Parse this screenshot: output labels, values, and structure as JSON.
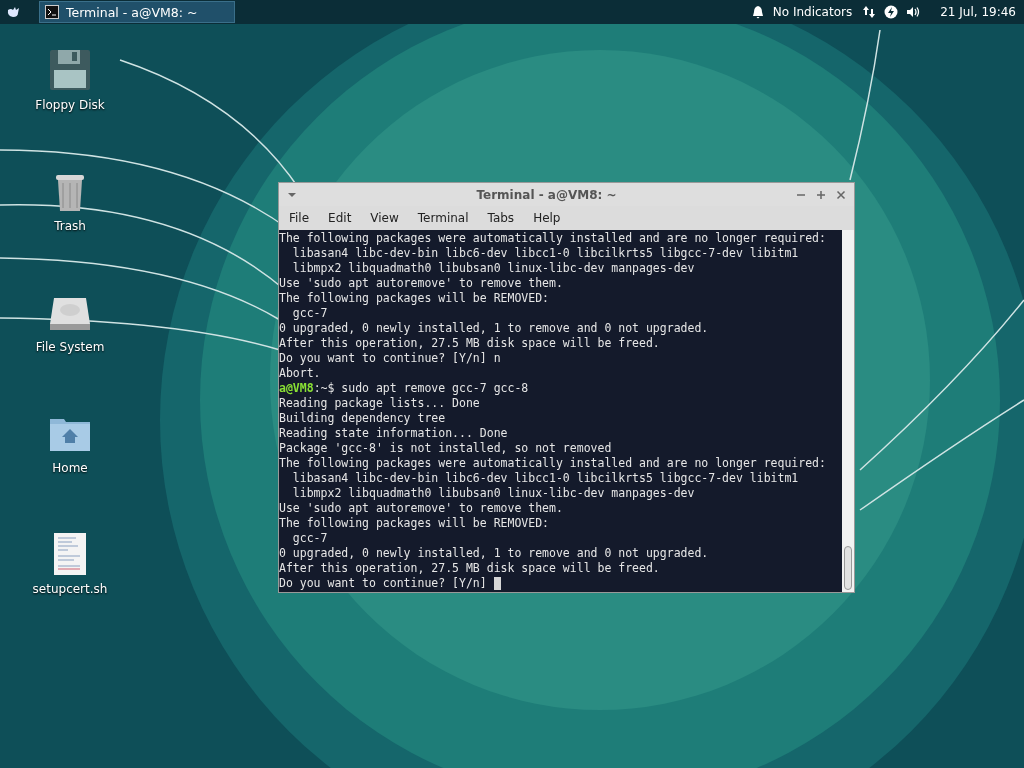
{
  "top_panel": {
    "taskbar": [
      {
        "title": "Terminal - a@VM8: ~",
        "selected": true
      }
    ],
    "indicator_label": "No Indicators",
    "clock": "21 Jul, 19:46"
  },
  "desktop_icons": [
    {
      "label": "Floppy Disk",
      "kind": "floppy"
    },
    {
      "label": "Trash",
      "kind": "trash"
    },
    {
      "label": "File System",
      "kind": "drive"
    },
    {
      "label": "Home",
      "kind": "home"
    },
    {
      "label": "setupcert.sh",
      "kind": "script"
    }
  ],
  "terminal": {
    "title": "Terminal - a@VM8: ~",
    "menu": [
      "File",
      "Edit",
      "View",
      "Terminal",
      "Tabs",
      "Help"
    ],
    "lines": [
      {
        "kind": "output",
        "text": "The following packages were automatically installed and are no longer required:"
      },
      {
        "kind": "output",
        "text": "  libasan4 libc-dev-bin libc6-dev libcc1-0 libcilkrts5 libgcc-7-dev libitm1"
      },
      {
        "kind": "output",
        "text": "  libmpx2 libquadmath0 libubsan0 linux-libc-dev manpages-dev"
      },
      {
        "kind": "output",
        "text": "Use 'sudo apt autoremove' to remove them."
      },
      {
        "kind": "output",
        "text": "The following packages will be REMOVED:"
      },
      {
        "kind": "output",
        "text": "  gcc-7"
      },
      {
        "kind": "output",
        "text": "0 upgraded, 0 newly installed, 1 to remove and 0 not upgraded."
      },
      {
        "kind": "output",
        "text": "After this operation, 27.5 MB disk space will be freed."
      },
      {
        "kind": "output",
        "text": "Do you want to continue? [Y/n] n"
      },
      {
        "kind": "output",
        "text": "Abort."
      },
      {
        "kind": "prompt",
        "user": "a@VM8",
        "text": ":~$ sudo apt remove gcc-7 gcc-8"
      },
      {
        "kind": "output",
        "text": "Reading package lists... Done"
      },
      {
        "kind": "output",
        "text": "Building dependency tree"
      },
      {
        "kind": "output",
        "text": "Reading state information... Done"
      },
      {
        "kind": "output",
        "text": "Package 'gcc-8' is not installed, so not removed"
      },
      {
        "kind": "output",
        "text": "The following packages were automatically installed and are no longer required:"
      },
      {
        "kind": "output",
        "text": "  libasan4 libc-dev-bin libc6-dev libcc1-0 libcilkrts5 libgcc-7-dev libitm1"
      },
      {
        "kind": "output",
        "text": "  libmpx2 libquadmath0 libubsan0 linux-libc-dev manpages-dev"
      },
      {
        "kind": "output",
        "text": "Use 'sudo apt autoremove' to remove them."
      },
      {
        "kind": "output",
        "text": "The following packages will be REMOVED:"
      },
      {
        "kind": "output",
        "text": "  gcc-7"
      },
      {
        "kind": "output",
        "text": "0 upgraded, 0 newly installed, 1 to remove and 0 not upgraded."
      },
      {
        "kind": "output",
        "text": "After this operation, 27.5 MB disk space will be freed."
      },
      {
        "kind": "pending",
        "text": "Do you want to continue? [Y/n] "
      }
    ]
  }
}
